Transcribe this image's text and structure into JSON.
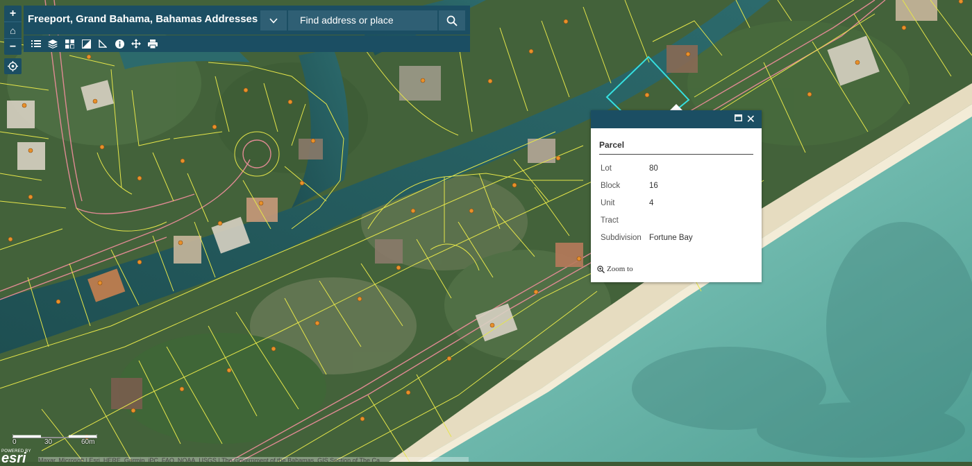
{
  "app": {
    "title": "Freeport, Grand Bahama, Bahamas Addresses"
  },
  "search": {
    "placeholder": "Find address or place"
  },
  "zoom": {
    "in": "+",
    "home": "⌂",
    "out": "−"
  },
  "toolbar": {
    "tools": [
      "legend-icon",
      "layers-icon",
      "basemap-gallery-icon",
      "overview-icon",
      "measure-icon",
      "about-icon",
      "directions-icon",
      "print-icon"
    ]
  },
  "popup": {
    "title": "Parcel",
    "fields": [
      {
        "label": "Lot",
        "value": "80"
      },
      {
        "label": "Block",
        "value": "16"
      },
      {
        "label": "Unit",
        "value": "4"
      },
      {
        "label": "Tract",
        "value": ""
      },
      {
        "label": "Subdivision",
        "value": "Fortune Bay"
      }
    ],
    "zoom_to": "Zoom to"
  },
  "scale": {
    "labels": [
      "0",
      "30",
      "60m"
    ]
  },
  "esri": {
    "powered_by": "POWERED BY",
    "logo": "esri"
  },
  "attribution": "Maxar, Microsoft | Esri, HERE, Garmin, iPC, FAO, NOAA, USGS | The Government of the Bahamas, GIS Section of The Ca..."
}
